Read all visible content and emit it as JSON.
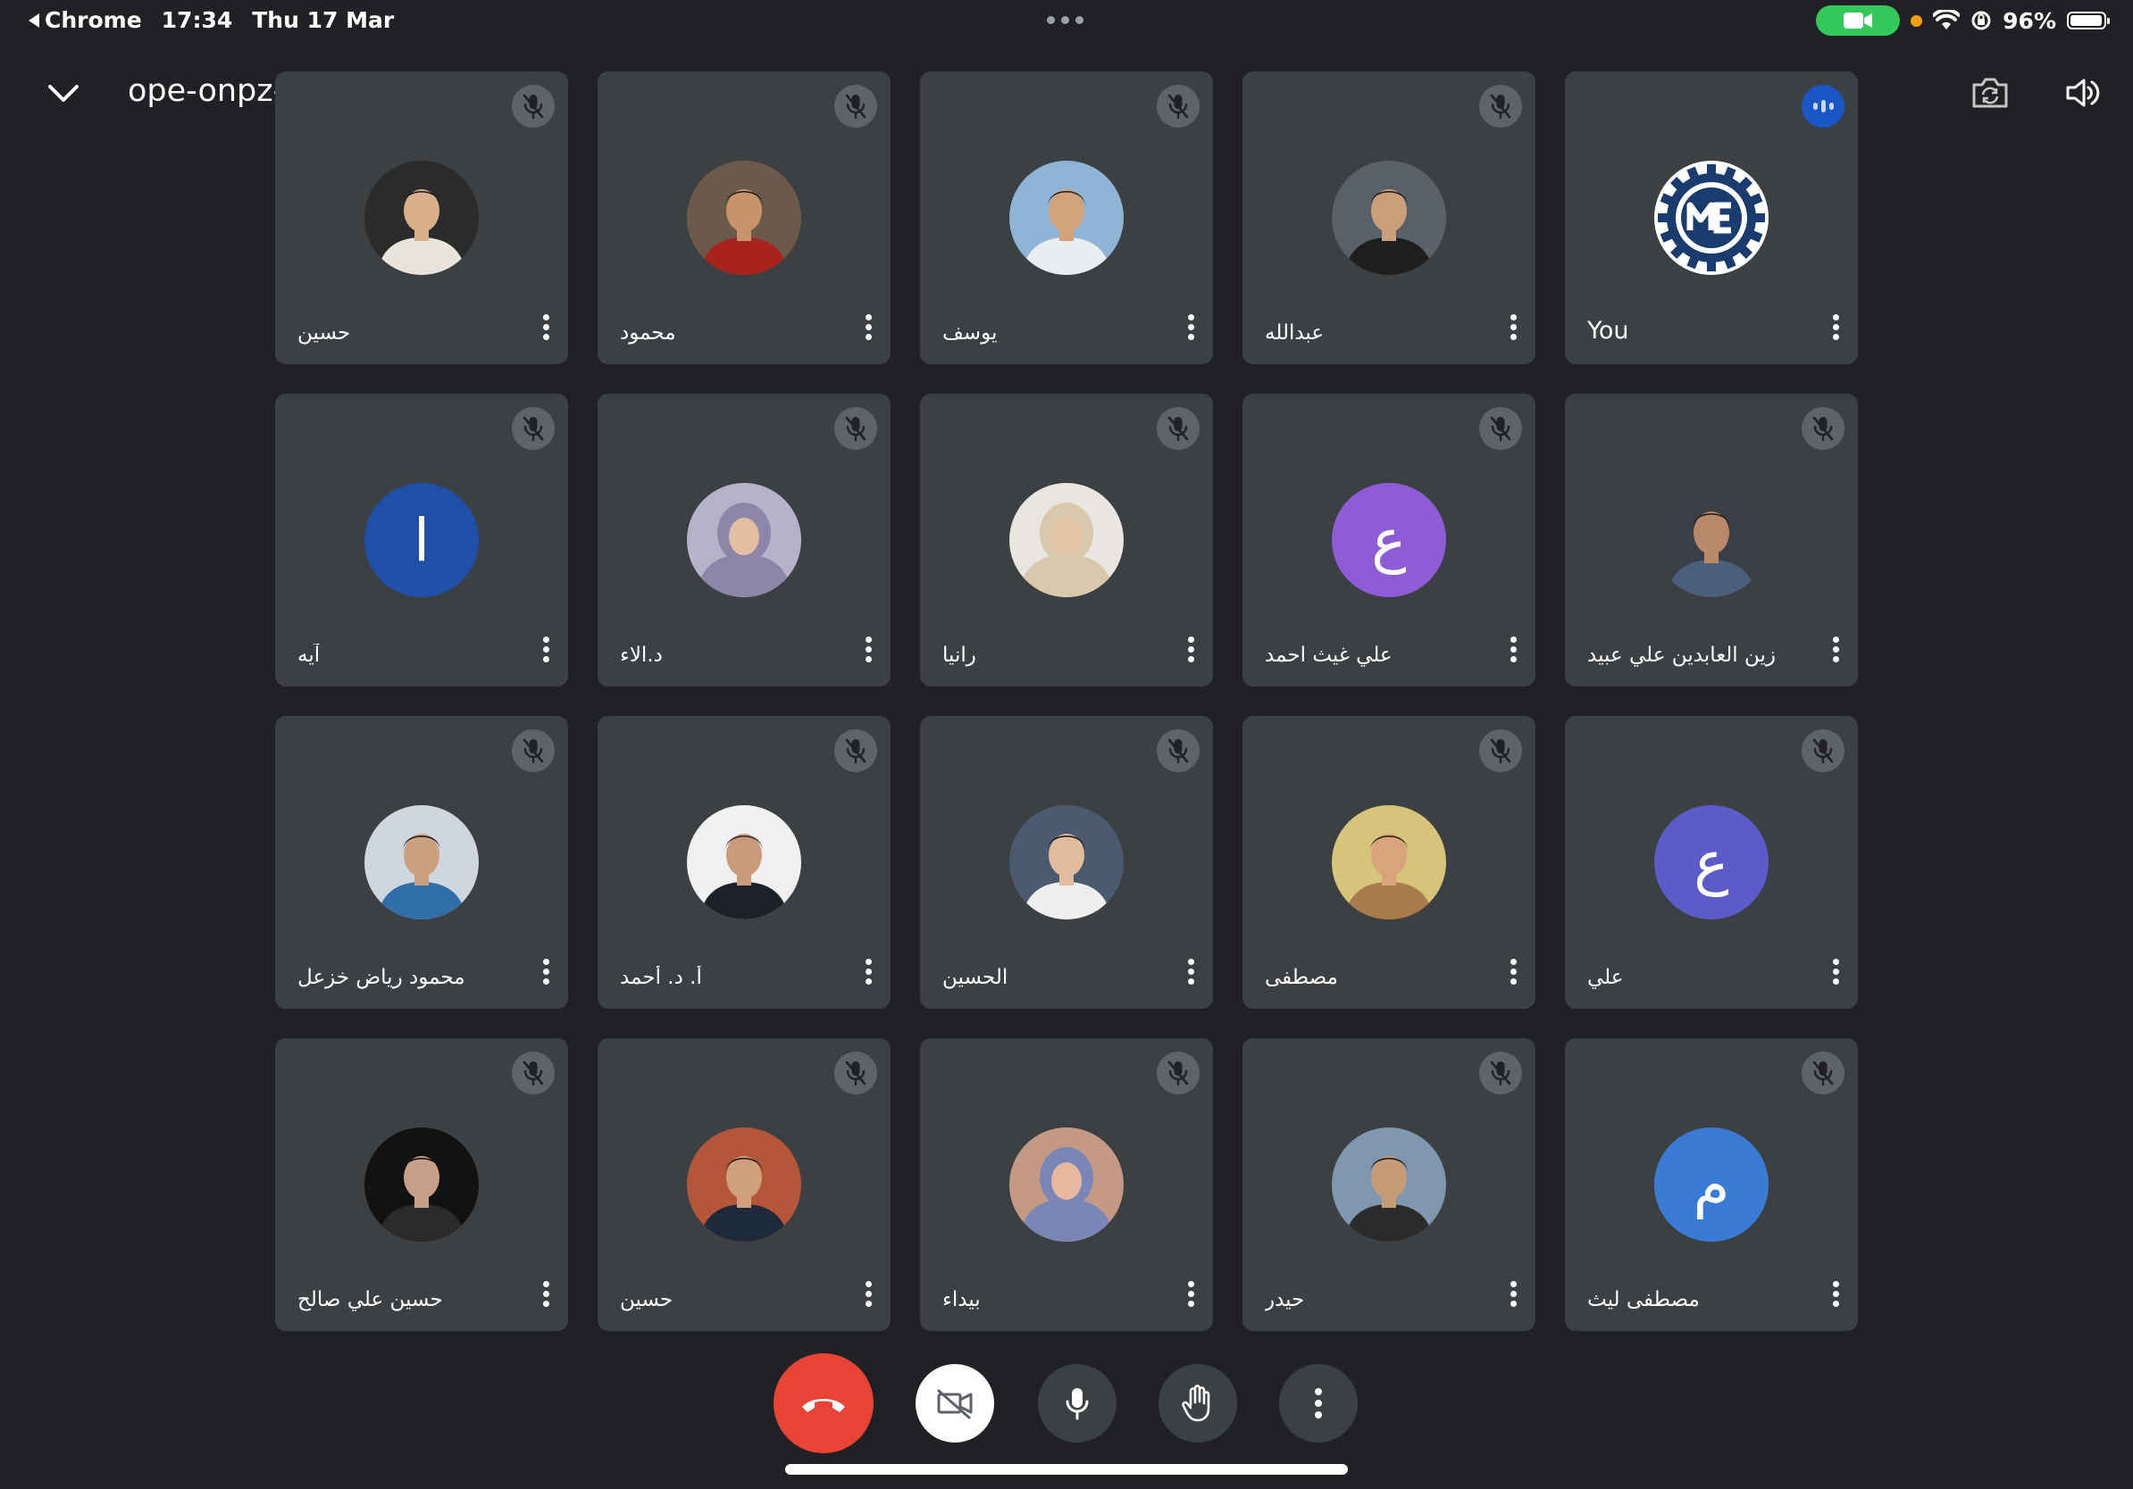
{
  "status_bar": {
    "back_app": "Chrome",
    "time": "17:34",
    "date": "Thu 17 Mar",
    "battery_percent": "96%",
    "battery_level": 0.96
  },
  "header": {
    "meeting_code": "ope-onpz-kek",
    "icons": {
      "collapse": "chevron-down-icon",
      "details": "caret-right-icon",
      "flip_camera": "camera-flip-icon",
      "audio": "speaker-icon"
    }
  },
  "colors": {
    "background": "#202124",
    "tile": "#3c4043",
    "end_call": "#ea4335",
    "speaking_indicator": "#1a56c4",
    "avatar_dark_blue": "#1f4fa8",
    "avatar_purple": "#8e5cd6",
    "avatar_indigo": "#5b5cc8",
    "avatar_blue": "#3a7bd5",
    "camera_indicator": "#34c759"
  },
  "participants": [
    {
      "name": "حسين",
      "muted": true
    },
    {
      "name": "محمود",
      "muted": true
    },
    {
      "name": "يوسف",
      "muted": true
    },
    {
      "name": "عبدالله",
      "muted": true
    },
    {
      "name": "You",
      "muted": false,
      "speaking": true
    },
    {
      "name": "آيه",
      "muted": true,
      "initial": "ا"
    },
    {
      "name": "د.الاء",
      "muted": true
    },
    {
      "name": "رانيا",
      "muted": true
    },
    {
      "name": "علي غيث احمد",
      "muted": true,
      "initial": "ع"
    },
    {
      "name": "زين العابدين علي عبيد",
      "muted": true
    },
    {
      "name": "محمود رياض خزعل",
      "muted": true
    },
    {
      "name": "أ. د. أحمد",
      "muted": true
    },
    {
      "name": "الحسين",
      "muted": true
    },
    {
      "name": "مصطفى",
      "muted": true
    },
    {
      "name": "علي",
      "muted": true,
      "initial": "ع"
    },
    {
      "name": "حسين علي صالح",
      "muted": true
    },
    {
      "name": "حسين",
      "muted": true
    },
    {
      "name": "بيداء",
      "muted": true
    },
    {
      "name": "حيدر",
      "muted": true
    },
    {
      "name": "مصطفى ليث",
      "muted": true,
      "initial": "م"
    }
  ],
  "controls": {
    "end_call": "phone-hangup-icon",
    "camera": "camera-off-icon",
    "mic": "microphone-icon",
    "raise_hand": "hand-icon",
    "more": "more-vertical-icon"
  }
}
